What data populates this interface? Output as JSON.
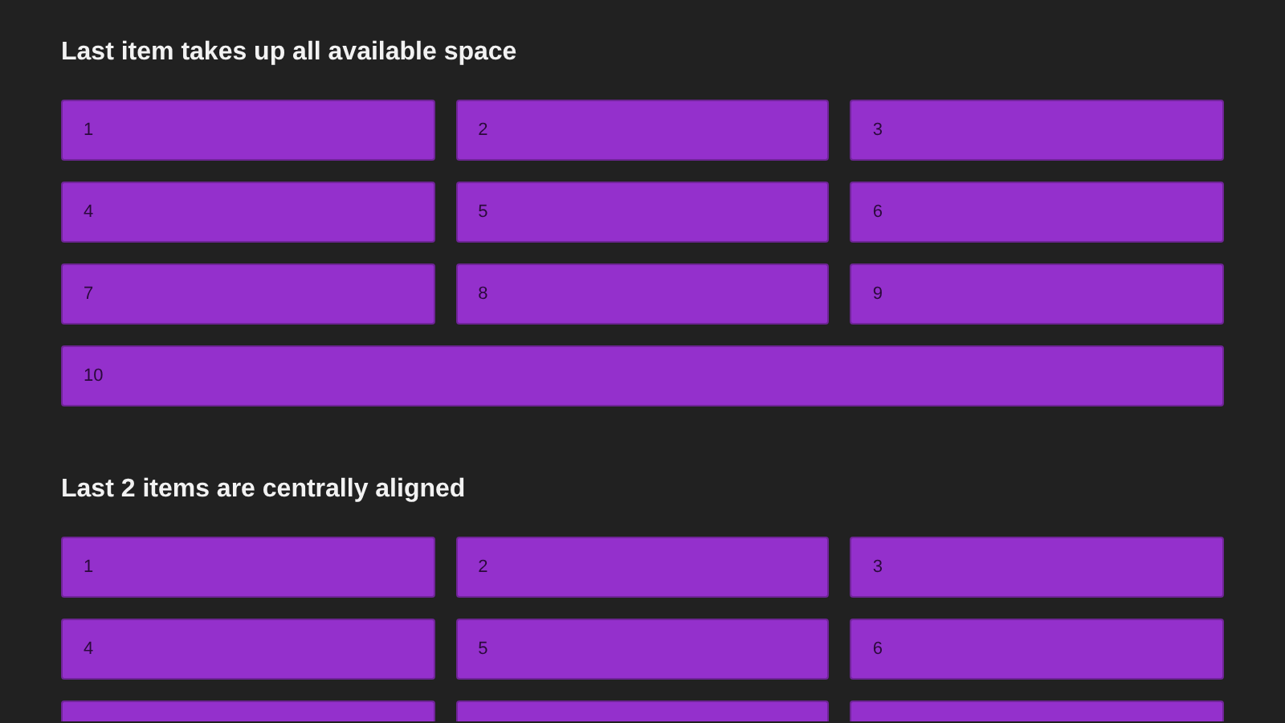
{
  "sections": [
    {
      "title": "Last item takes up all available space",
      "items": [
        {
          "kind": "box",
          "label": "1"
        },
        {
          "kind": "box",
          "label": "2"
        },
        {
          "kind": "box",
          "label": "3"
        },
        {
          "kind": "box",
          "label": "4"
        },
        {
          "kind": "box",
          "label": "5"
        },
        {
          "kind": "box",
          "label": "6"
        },
        {
          "kind": "box",
          "label": "7"
        },
        {
          "kind": "box",
          "label": "8"
        },
        {
          "kind": "box",
          "label": "9"
        },
        {
          "kind": "wide",
          "label": "10"
        }
      ]
    },
    {
      "title": "Last 2 items are centrally aligned",
      "items": [
        {
          "kind": "box",
          "label": "1"
        },
        {
          "kind": "box",
          "label": "2"
        },
        {
          "kind": "box",
          "label": "3"
        },
        {
          "kind": "box",
          "label": "4"
        },
        {
          "kind": "box",
          "label": "5"
        },
        {
          "kind": "box",
          "label": "6"
        },
        {
          "kind": "partial"
        },
        {
          "kind": "partial"
        },
        {
          "kind": "partial"
        }
      ]
    }
  ]
}
